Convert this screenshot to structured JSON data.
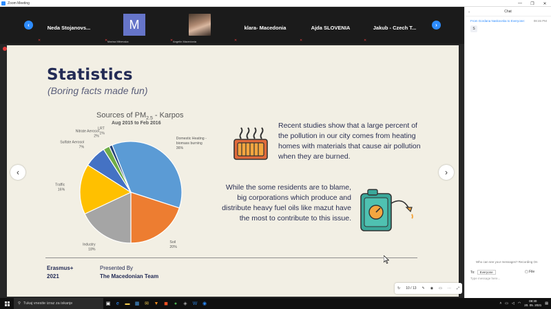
{
  "window": {
    "title": "Zoom Meeting",
    "controls": [
      "—",
      "❐",
      "✕"
    ]
  },
  "participants": [
    {
      "name": "Neda  Stojanovs...",
      "type": "name"
    },
    {
      "name": "Marina Mitrevska",
      "initial": "M",
      "type": "avatar"
    },
    {
      "name": "Angelin Macedonia",
      "type": "photo"
    },
    {
      "name": "klara- Macedonia",
      "type": "name"
    },
    {
      "name": "Ajda SLOVENIA",
      "type": "name"
    },
    {
      "name": "Jakub  - Czech T...",
      "type": "name"
    }
  ],
  "slide": {
    "title": "Statistics",
    "subtitle": "(Boring facts made fun)",
    "paragraph1": "Recent studies show that a large percent of the pollution in our city comes from heating homes with materials that cause air pollution when they are burned.",
    "paragraph2": "While the some residents are to blame, big corporations which produce and distribute heavy fuel oils like mazut have the most to contribute to this issue.",
    "footer_left_1": "Erasmus+",
    "footer_left_2": "2021",
    "footer_right_1": "Presented By",
    "footer_right_2": "The Macedonian Team",
    "page_indicator": "10 / 13",
    "colors": {
      "title": "#232b55",
      "background": "#f2efe4"
    }
  },
  "chart_data": {
    "type": "pie",
    "title": "Sources of PM2.5 - Karpos",
    "title_main": "Sources of PM",
    "title_sub": "2.5",
    "title_rest": " - Karpos",
    "subtitle": "Aug 2015 to Feb 2016",
    "slices": [
      {
        "label": "Domestic Heating - biomass burning",
        "value": 36,
        "display": "36%",
        "color": "#5b9bd5"
      },
      {
        "label": "Soil",
        "value": 20,
        "display": "20%",
        "color": "#ed7d31"
      },
      {
        "label": "Industry",
        "value": 18,
        "display": "18%",
        "color": "#a5a5a5"
      },
      {
        "label": "Traffic",
        "value": 16,
        "display": "16%",
        "color": "#ffc000"
      },
      {
        "label": "Sulfate Aerosol",
        "value": 7,
        "display": "7%",
        "color": "#4472c4"
      },
      {
        "label": "Nitrate Aerosol",
        "value": 2,
        "display": "2%",
        "color": "#70ad47"
      },
      {
        "label": "LRT",
        "value": 1,
        "display": "1%",
        "color": "#264478"
      }
    ]
  },
  "chat": {
    "header": "Chat",
    "message_from": "From Gordana Naskovska to Everyone:",
    "message_time": "08:46 PM",
    "message_body": "S",
    "who_can_see": "Who can see your messages? Recording On",
    "to_label": "To:",
    "to_value": "Everyone",
    "file_label": "File",
    "input_placeholder": "Type message here..."
  },
  "taskbar": {
    "search_placeholder": "Tukaj vnesite izraz za iskanje",
    "time": "08:30",
    "date": "20. 05. 2021"
  }
}
